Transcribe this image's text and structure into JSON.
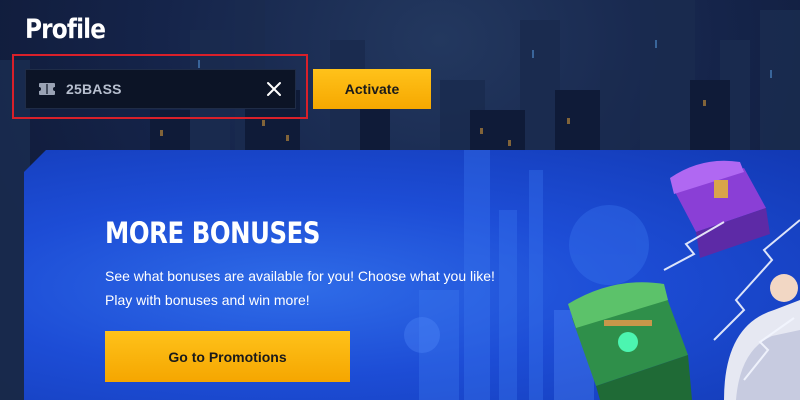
{
  "page": {
    "title": "Profile"
  },
  "promo_code": {
    "value": "25BASS",
    "ticket_icon": "ticket-icon",
    "clear_icon": "close-icon",
    "activate_label": "Activate",
    "highlight_color": "#d9202a"
  },
  "banner": {
    "title": "MORE BONUSES",
    "description": "See what bonuses are available for you! Choose what you like! Play with bonuses and win more!",
    "button_label": "Go to Promotions"
  },
  "colors": {
    "accent": "#ffb800",
    "banner_blue": "#1d4dd6",
    "background": "#101a33"
  }
}
